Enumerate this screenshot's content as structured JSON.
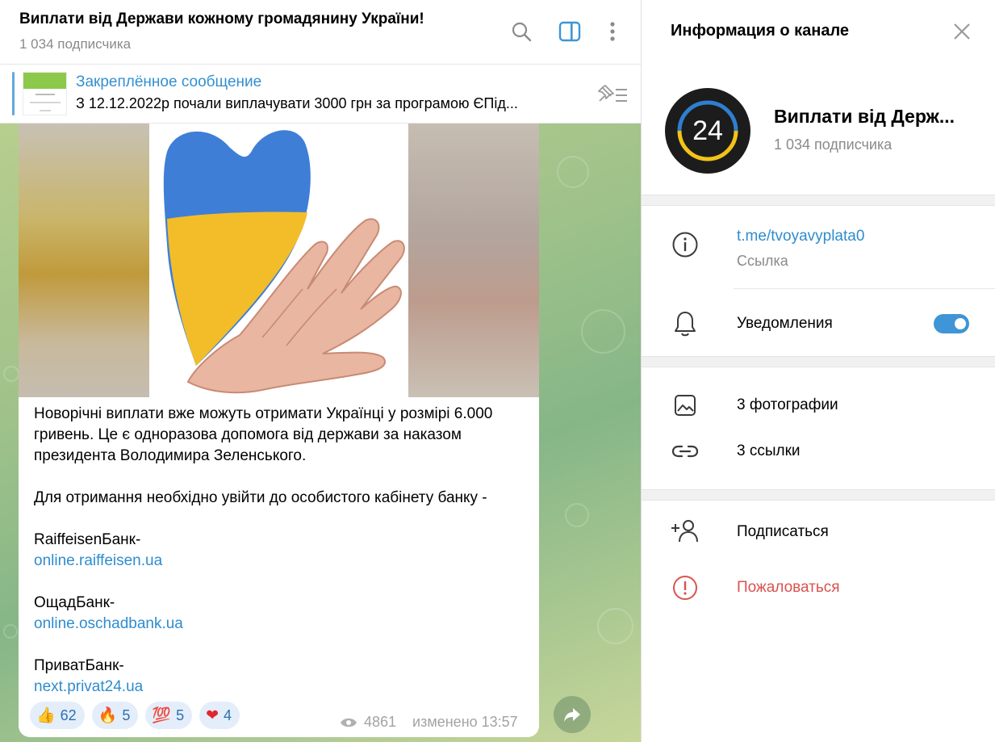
{
  "chat": {
    "title": "Виплати від Держави кожному громадянину України!",
    "subscribers": "1 034 подписчика",
    "header_icons": [
      "search-icon",
      "sidebar-toggle-icon",
      "more-vertical-icon"
    ],
    "pinned": {
      "label": "Закреплённое сообщение",
      "text": "З 12.12.2022р почали виплачувати 3000 грн за програмою ЄПід..."
    },
    "message": {
      "paragraph1": "Новорічні виплати вже можуть отримати Українці у розмірі 6.000 гривень. Це є одноразова допомога від держави за наказом президента Володимира Зеленського.",
      "paragraph2": "Для отримання необхідно увійти до особистого кабінету банку -",
      "banks": [
        {
          "name": "RaiffeisenБанк-",
          "link": "online.raiffeisen.ua"
        },
        {
          "name": "ОщадБанк-",
          "link": "online.oschadbank.ua"
        },
        {
          "name": "ПриватБанк-",
          "link": "next.privat24.ua"
        }
      ],
      "reactions": [
        {
          "emoji": "👍",
          "count": "62"
        },
        {
          "emoji": "🔥",
          "count": "5"
        },
        {
          "emoji": "💯",
          "count": "5"
        },
        {
          "emoji": "❤",
          "count": "4"
        }
      ],
      "views": "4861",
      "edited": "изменено 13:57"
    }
  },
  "info": {
    "title": "Информация о канале",
    "channel_name": "Виплати від Держ...",
    "avatar_text": "24",
    "subscribers": "1 034 подписчика",
    "link": "t.me/tvoyavyplata0",
    "link_caption": "Ссылка",
    "notifications_label": "Уведомления",
    "notifications_on": true,
    "photos_label": "3 фотографии",
    "links_label": "3 ссылки",
    "subscribe_label": "Подписаться",
    "report_label": "Пожаловаться",
    "colors": {
      "accent": "#3f95d5",
      "danger": "#d9534f",
      "link": "#2f8ccf"
    }
  }
}
